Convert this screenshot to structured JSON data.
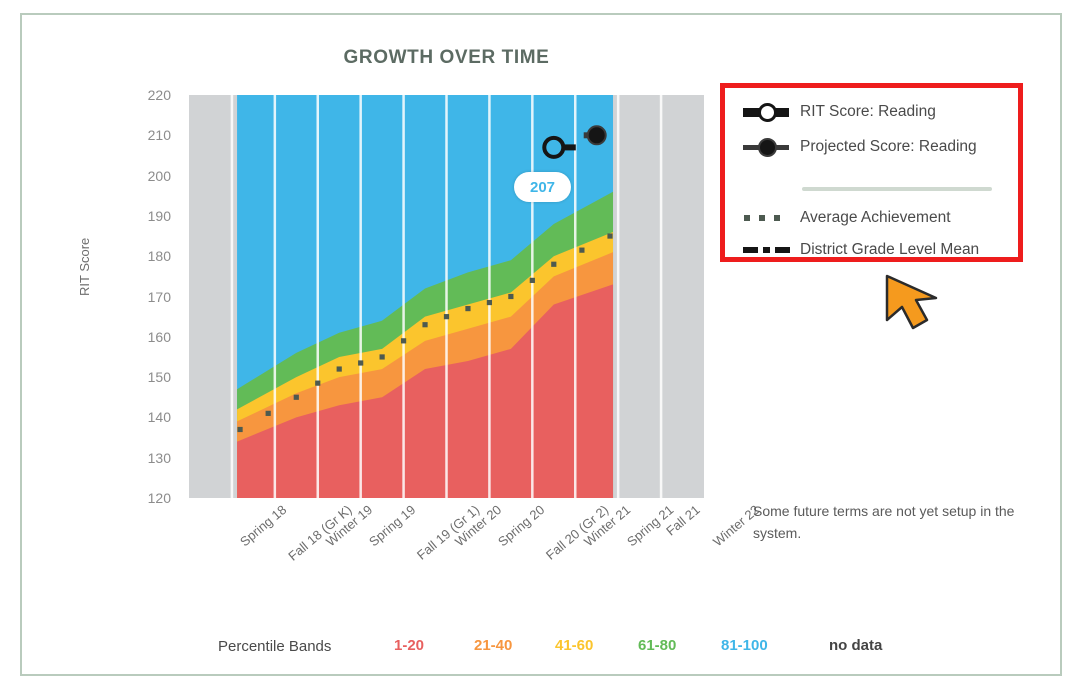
{
  "chart_title": "GROWTH OVER TIME",
  "y_axis_label": "RIT Score",
  "future_note": "Some future terms are not yet setup in the system.",
  "callout": {
    "value": "207",
    "color": "#3fb6e8"
  },
  "legend": {
    "items": [
      {
        "label": "RIT Score: Reading",
        "marker": "bar-hollow-circle",
        "color": "#151515"
      },
      {
        "label": "Projected Score: Reading",
        "marker": "line-filled-circle",
        "color": "#151515"
      },
      {
        "label": "Average Achievement",
        "marker": "dotted",
        "color": "#4d5a50"
      },
      {
        "label": "District Grade Level Mean",
        "marker": "dash-dot",
        "color": "#151515"
      }
    ],
    "highlight_border_color": "#ee1d1d"
  },
  "band_legend": {
    "title": "Percentile Bands",
    "entries": [
      {
        "label": "1-20",
        "color": "#e8605f"
      },
      {
        "label": "21-40",
        "color": "#f7963f"
      },
      {
        "label": "41-60",
        "color": "#fbc52d"
      },
      {
        "label": "61-80",
        "color": "#62bb57"
      },
      {
        "label": "81-100",
        "color": "#3fb6e8"
      },
      {
        "label": "no data",
        "color": "#444444"
      }
    ]
  },
  "chart_data": {
    "type": "area",
    "title": "GROWTH OVER TIME",
    "xlabel": "",
    "ylabel": "RIT Score",
    "ylim": [
      120,
      220
    ],
    "yticks": [
      220,
      210,
      200,
      190,
      180,
      170,
      160,
      150,
      140,
      130,
      120
    ],
    "grid": true,
    "legend_position": "right",
    "categories": [
      "Spring 18",
      "Fall 18 (Gr K)",
      "Winter 19",
      "Spring 19",
      "Fall 19 (Gr 1)",
      "Winter 20",
      "Spring 20",
      "Fall 20 (Gr 2)",
      "Winter 21",
      "Spring 21",
      "Fall 21",
      "Winter 22"
    ],
    "no_data_categories": [
      "Spring 18",
      "Fall 21",
      "Winter 22"
    ],
    "band_colors": {
      "1-20": "#e8605f",
      "21-40": "#f7963f",
      "41-60": "#fbc52d",
      "61-80": "#62bb57",
      "81-100": "#3fb6e8",
      "no data": "#d1d3d5"
    },
    "percentile_band_boundaries": {
      "note": "Upper RIT edge of each percentile band per term (bands drawn Fall 18 through Spring 21)",
      "terms": [
        "Fall 18 (Gr K)",
        "Winter 19",
        "Spring 19",
        "Fall 19 (Gr 1)",
        "Winter 20",
        "Spring 20",
        "Fall 20 (Gr 2)",
        "Winter 21",
        "Spring 21"
      ],
      "p20": [
        134,
        140,
        143,
        145,
        152,
        154,
        157,
        168,
        173
      ],
      "p40": [
        139,
        146,
        150,
        152,
        159,
        162,
        165,
        175,
        181
      ],
      "p60": [
        142,
        150,
        155,
        157,
        165,
        168,
        171,
        180,
        186
      ],
      "p80": [
        147,
        156,
        161,
        164,
        172,
        176,
        179,
        188,
        196
      ]
    },
    "series": [
      {
        "name": "Average Achievement",
        "style": "dotted",
        "color": "#4d5a50",
        "terms": [
          "Fall 18 (Gr K)",
          "Winter 19",
          "Spring 19",
          "Fall 19 (Gr 1)",
          "Winter 20",
          "Spring 20",
          "Fall 20 (Gr 2)",
          "Winter 21",
          "Spring 21"
        ],
        "values": [
          137,
          145,
          152,
          155,
          163,
          167,
          170,
          178,
          185
        ]
      },
      {
        "name": "RIT Score: Reading",
        "style": "hollow-circle-marker",
        "color": "#151515",
        "terms": [
          "Winter 21"
        ],
        "values": [
          207
        ]
      },
      {
        "name": "Projected Score: Reading",
        "style": "filled-circle-marker",
        "color": "#151515",
        "terms": [
          "Spring 21"
        ],
        "values": [
          210
        ]
      }
    ]
  }
}
